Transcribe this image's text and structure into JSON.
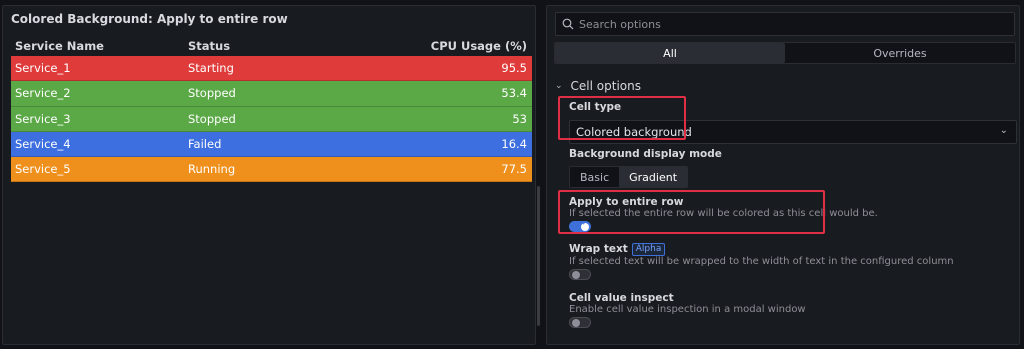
{
  "left_panel": {
    "title": "Colored Background: Apply to entire row",
    "columns": [
      "Service Name",
      "Status",
      "CPU Usage (%)"
    ],
    "rows": [
      {
        "name": "Service_1",
        "status": "Starting",
        "cpu": "95.5",
        "color": "#e03b3b"
      },
      {
        "name": "Service_2",
        "status": "Stopped",
        "cpu": "53.4",
        "color": "#5ba847"
      },
      {
        "name": "Service_3",
        "status": "Stopped",
        "cpu": "53",
        "color": "#5ba847"
      },
      {
        "name": "Service_4",
        "status": "Failed",
        "cpu": "16.4",
        "color": "#3d6fe0"
      },
      {
        "name": "Service_5",
        "status": "Running",
        "cpu": "77.5",
        "color": "#ef8f1c"
      }
    ]
  },
  "options_pane": {
    "search_placeholder": "Search options",
    "tabs": [
      "All",
      "Overrides"
    ],
    "active_tab": "All",
    "section_title": "Cell options",
    "cell_type": {
      "label": "Cell type",
      "value": "Colored background"
    },
    "bg_mode": {
      "label": "Background display mode",
      "options": [
        "Basic",
        "Gradient"
      ],
      "selected": "Gradient"
    },
    "apply_row": {
      "label": "Apply to entire row",
      "description": "If selected the entire row will be colored as this cell would be.",
      "enabled": true
    },
    "wrap_text": {
      "label": "Wrap text",
      "badge": "Alpha",
      "description": "If selected text will be wrapped to the width of text in the configured column",
      "enabled": false
    },
    "cell_inspect": {
      "label": "Cell value inspect",
      "description": "Enable cell value inspection in a modal window",
      "enabled": false
    }
  },
  "colors": {
    "background": "#111217",
    "panel": "#181b1f",
    "accent": "#3d71d9",
    "highlight": "#e02f44"
  }
}
